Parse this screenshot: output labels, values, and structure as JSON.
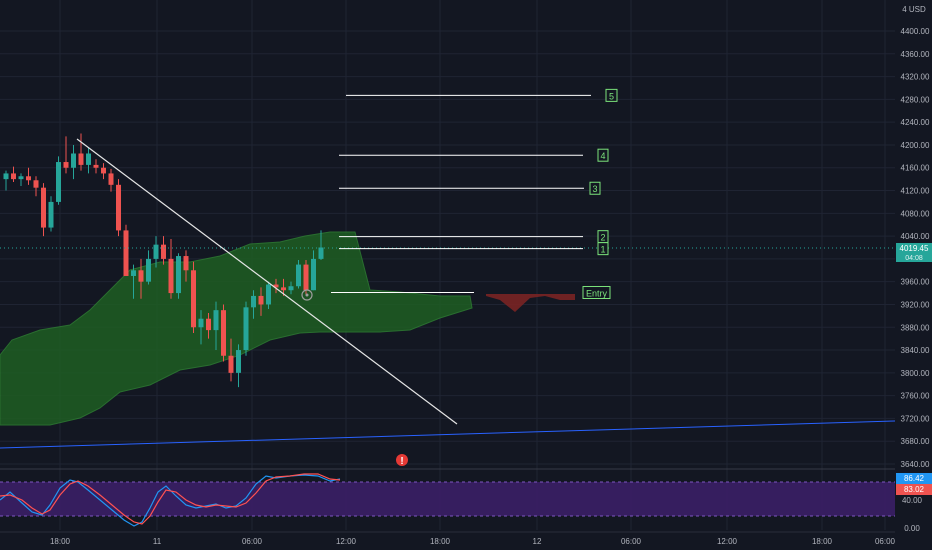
{
  "colors": {
    "background": "#131722",
    "grid": "#1f2433",
    "bull": "#26a69a",
    "bear": "#ef5350",
    "cloud": "#1e5e23",
    "cloud_edge": "#2e7d32",
    "cloud_red": "#7a2424",
    "trendline": "#e6e6e6",
    "blue_line": "#2962ff",
    "stoch_band": "#3b1f66",
    "stoch_k": "#2196f3",
    "stoch_d": "#ff5252",
    "target_box": "#7be37b",
    "price_tag": "#26a69a",
    "alert": "#e53935"
  },
  "price_axis": {
    "currency": "USD",
    "currency_prefix": "4",
    "ticks": [
      "4400.00",
      "4360.00",
      "4320.00",
      "4280.00",
      "4240.00",
      "4200.00",
      "4160.00",
      "4120.00",
      "4080.00",
      "4040.00",
      "4000.00",
      "3960.00",
      "3920.00",
      "3880.00",
      "3840.00",
      "3800.00",
      "3760.00",
      "3720.00",
      "3680.00",
      "3640.00"
    ],
    "current_price": "4019.45",
    "countdown": "04:08"
  },
  "time_axis": {
    "ticks": [
      "18:00",
      "11",
      "06:00",
      "12:00",
      "18:00",
      "12",
      "06:00",
      "12:00",
      "18:00",
      "06:00"
    ]
  },
  "targets": [
    {
      "label": "5",
      "price": 4287
    },
    {
      "label": "4",
      "price": 4182
    },
    {
      "label": "3",
      "price": 4124
    },
    {
      "label": "2",
      "price": 4039
    },
    {
      "label": "1",
      "price": 4018
    },
    {
      "label": "Entry",
      "price": 3941
    }
  ],
  "chart_data": {
    "type": "candlestick",
    "ylim": [
      3620,
      4420
    ],
    "price_scale_ticks": [
      4400,
      4360,
      4320,
      4280,
      4240,
      4200,
      4160,
      4120,
      4080,
      4040,
      4000,
      3960,
      3920,
      3880,
      3840,
      3800,
      3760,
      3720,
      3680,
      3640
    ],
    "candles": [
      [
        4140,
        4155,
        4120,
        4150
      ],
      [
        4150,
        4162,
        4135,
        4140
      ],
      [
        4140,
        4150,
        4128,
        4145
      ],
      [
        4145,
        4160,
        4130,
        4138
      ],
      [
        4138,
        4145,
        4110,
        4125
      ],
      [
        4125,
        4133,
        4040,
        4055
      ],
      [
        4055,
        4110,
        4048,
        4100
      ],
      [
        4100,
        4180,
        4095,
        4170
      ],
      [
        4170,
        4215,
        4150,
        4160
      ],
      [
        4160,
        4200,
        4140,
        4185
      ],
      [
        4185,
        4220,
        4155,
        4165
      ],
      [
        4165,
        4195,
        4150,
        4185
      ],
      [
        4165,
        4175,
        4150,
        4160
      ],
      [
        4160,
        4168,
        4140,
        4150
      ],
      [
        4150,
        4158,
        4118,
        4130
      ],
      [
        4130,
        4140,
        4040,
        4050
      ],
      [
        4050,
        4060,
        3990,
        3970
      ],
      [
        3970,
        3990,
        3930,
        3980
      ],
      [
        3980,
        4000,
        3930,
        3960
      ],
      [
        3960,
        4015,
        3955,
        4000
      ],
      [
        4000,
        4040,
        3985,
        4025
      ],
      [
        4025,
        4040,
        3990,
        4000
      ],
      [
        4000,
        4035,
        3930,
        3940
      ],
      [
        3940,
        4010,
        3930,
        4005
      ],
      [
        4005,
        4015,
        3960,
        3980
      ],
      [
        3980,
        3995,
        3870,
        3880
      ],
      [
        3880,
        3910,
        3850,
        3895
      ],
      [
        3895,
        3905,
        3860,
        3875
      ],
      [
        3875,
        3925,
        3840,
        3910
      ],
      [
        3910,
        3920,
        3820,
        3830
      ],
      [
        3830,
        3860,
        3785,
        3800
      ],
      [
        3800,
        3850,
        3775,
        3840
      ],
      [
        3840,
        3925,
        3830,
        3915
      ],
      [
        3915,
        3945,
        3895,
        3935
      ],
      [
        3935,
        3950,
        3900,
        3920
      ],
      [
        3920,
        3960,
        3912,
        3955
      ],
      [
        3955,
        3965,
        3940,
        3950
      ],
      [
        3950,
        3965,
        3935,
        3945
      ],
      [
        3945,
        3960,
        3938,
        3952
      ],
      [
        3952,
        3998,
        3948,
        3990
      ],
      [
        3990,
        3998,
        3938,
        3945
      ],
      [
        3945,
        4015,
        3945,
        4000
      ],
      [
        4000,
        4050,
        3998,
        4020
      ]
    ],
    "stoch_rsi": {
      "levels": [
        80,
        20
      ],
      "ticks": [
        "40.00",
        "0.00"
      ],
      "k_value": "86.42",
      "d_value": "83.02"
    }
  },
  "alert_icon": "alert-icon",
  "cursor_icon": "cursor-target-icon"
}
